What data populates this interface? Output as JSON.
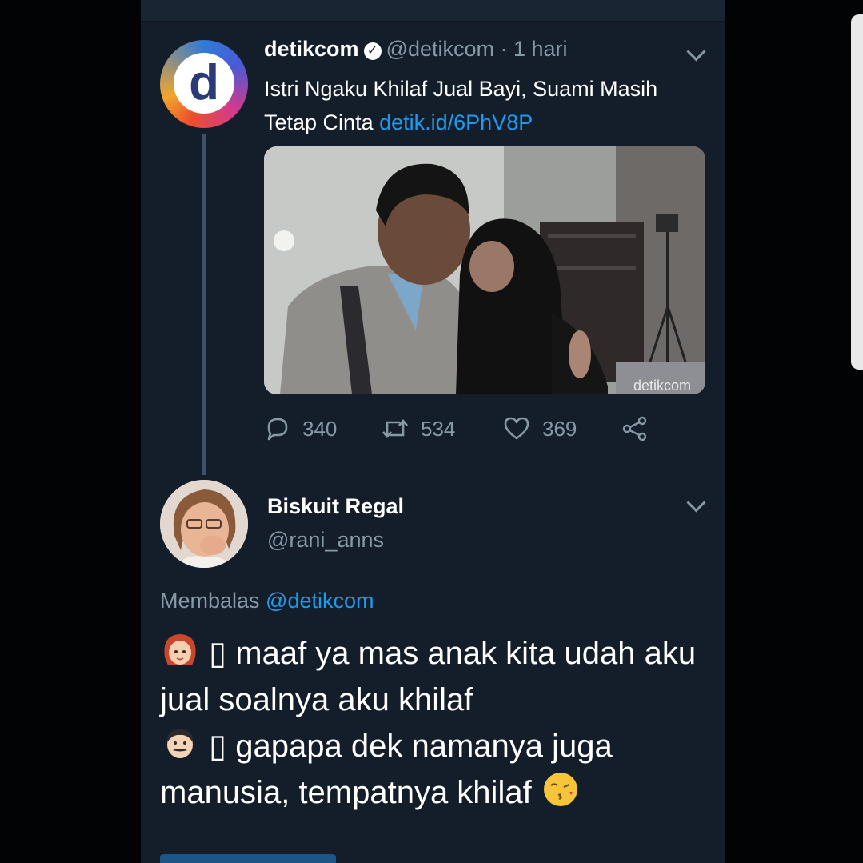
{
  "tweet": {
    "avatar_letter": "d",
    "name": "detikcom",
    "handle": "@detikcom",
    "separator": " · ",
    "time": "1 hari",
    "text": "Istri Ngaku Khilaf Jual Bayi, Suami Masih Tetap Cinta ",
    "link": "detik.id/6PhV8P",
    "watermark": "detikcom",
    "counts": {
      "replies": "340",
      "retweets": "534",
      "likes": "369"
    }
  },
  "reply": {
    "name": "Biskuit Regal",
    "handle": "@rani_anns",
    "replying_label": "Membalas ",
    "replying_to": "@detikcom",
    "line1": "▯ maaf ya mas anak kita udah aku jual soalnya aku khilaf",
    "line2": "▯ gapapa dek namanya juga manusia, tempatnya khilaf"
  },
  "icons": {
    "verified": "verified-badge-icon",
    "reply": "reply-bubble-icon",
    "retweet": "retweet-icon",
    "like": "heart-icon",
    "share": "share-icon",
    "menu": "chevron-down-icon"
  },
  "colors": {
    "background": "#141d2a",
    "link": "#1d9bf0",
    "secondary_text": "#8899a6"
  }
}
